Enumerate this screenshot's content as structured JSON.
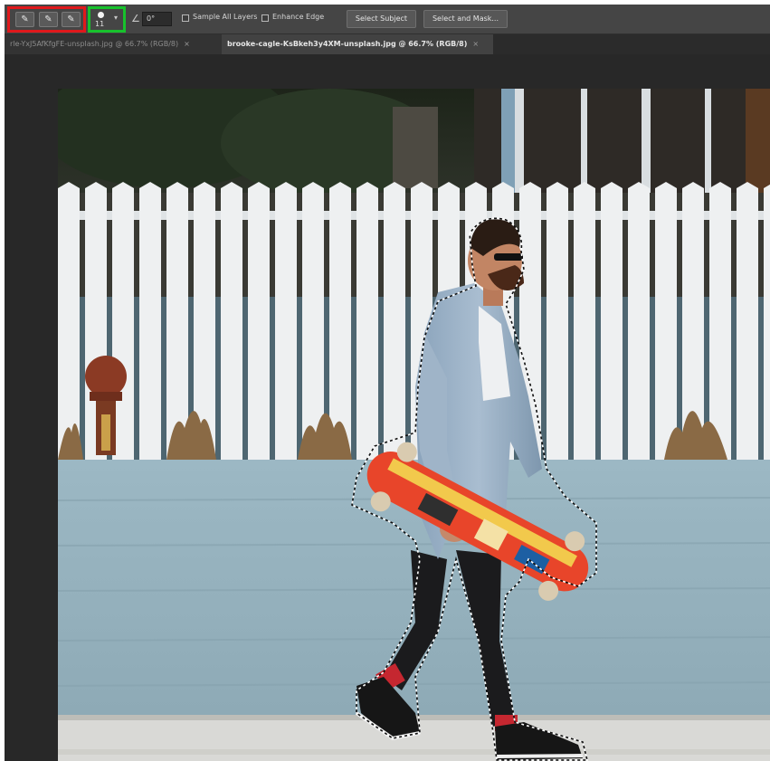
{
  "options_bar": {
    "brush_size": "11",
    "angle_value": "0°",
    "sample_all_layers_label": "Sample All Layers",
    "enhance_edge_label": "Enhance Edge",
    "select_subject_label": "Select Subject",
    "select_and_mask_label": "Select and Mask...",
    "highlight_colors": {
      "tool_modes": "#e0181b",
      "brush_picker": "#17c22c"
    }
  },
  "tabs": [
    {
      "label": "rle-YxJ5AfKfgFE-unsplash.jpg @ 66.7% (RGB/8)",
      "close": "×",
      "active": false
    },
    {
      "label": "brooke-cagle-KsBkeh3y4XM-unsplash.jpg @ 66.7% (RGB/8)",
      "close": "×",
      "active": true
    }
  ]
}
